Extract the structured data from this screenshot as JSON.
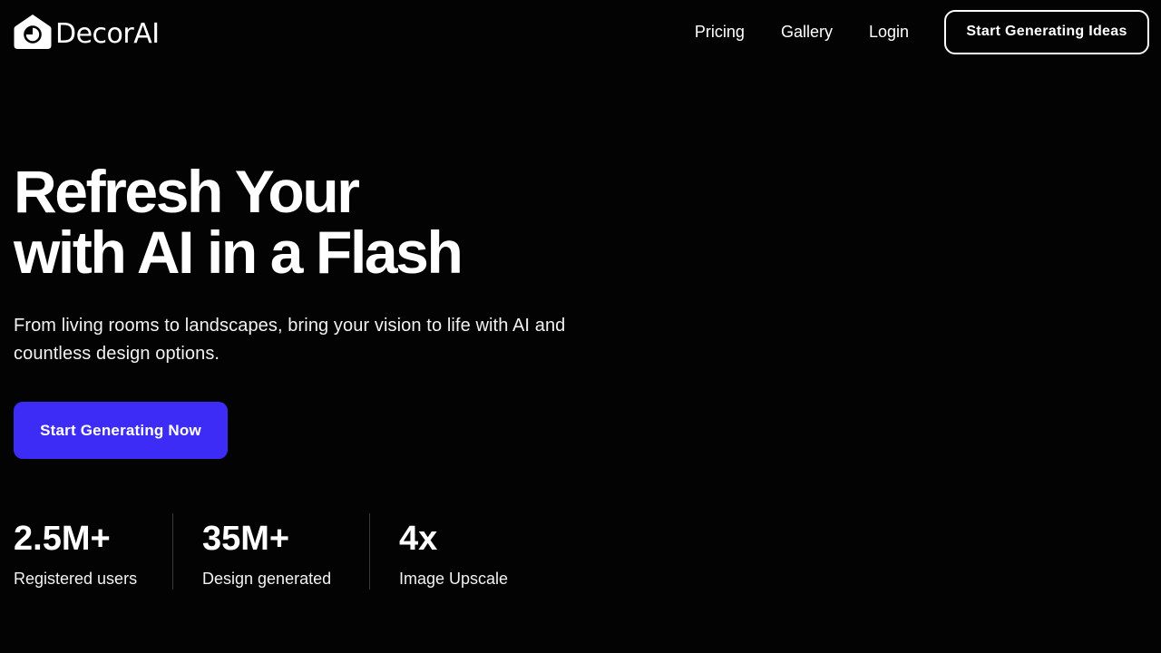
{
  "brand": {
    "name": "DecorAI",
    "icon": "house-clock-icon"
  },
  "nav": {
    "links": [
      {
        "label": "Pricing"
      },
      {
        "label": "Gallery"
      },
      {
        "label": "Login"
      }
    ],
    "cta_label": "Start Generating Ideas"
  },
  "hero": {
    "title_line1": "Refresh Your",
    "title_line2": "with AI in a Flash",
    "subtitle": "From living rooms to landscapes, bring your vision to life with AI and countless design options.",
    "cta_label": "Start Generating Now"
  },
  "stats": [
    {
      "value": "2.5M+",
      "label": "Registered users"
    },
    {
      "value": "35M+",
      "label": "Design generated"
    },
    {
      "value": "4x",
      "label": "Image Upscale"
    }
  ],
  "colors": {
    "background": "#030303",
    "accent": "#3d2cf5",
    "text": "#ffffff"
  }
}
